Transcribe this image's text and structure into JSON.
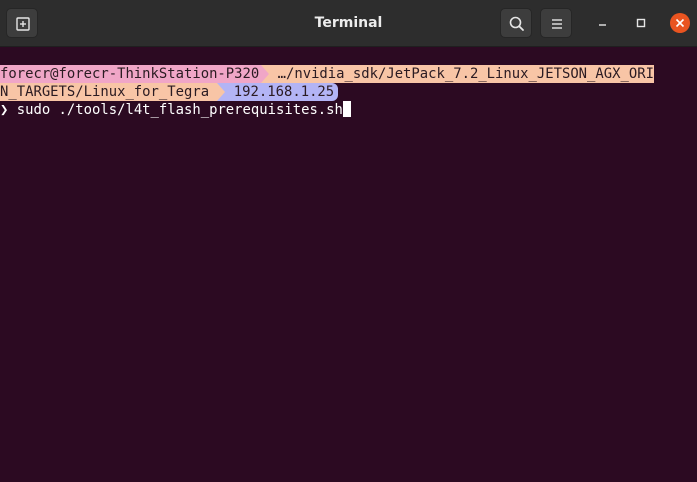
{
  "window": {
    "title": "Terminal"
  },
  "icons": {
    "new_tab": "new-tab-icon",
    "search": "search-icon",
    "menu": "hamburger-menu-icon",
    "minimize": "minimize-icon",
    "maximize": "maximize-icon",
    "close": "close-icon"
  },
  "colors": {
    "terminal_bg": "#2c0a22",
    "titlebar_bg": "#2d2d2d",
    "user_segment": "#f0a6c7",
    "path_segment": "#f8c5a6",
    "ip_segment": "#b3b4f5",
    "close_button": "#e95420"
  },
  "prompt": {
    "user_host": "forecr@forecr-ThinkStation-P320",
    "path_line1": " …/nvidia_sdk/JetPack_7.2_Linux_JETSON_AGX_ORI",
    "path_line2": "N_TARGETS/Linux_for_Tegra ",
    "ip": " 192.168.1.25",
    "prompt_symbol": "❯",
    "command": " sudo ./tools/l4t_flash_prerequisites.sh"
  }
}
